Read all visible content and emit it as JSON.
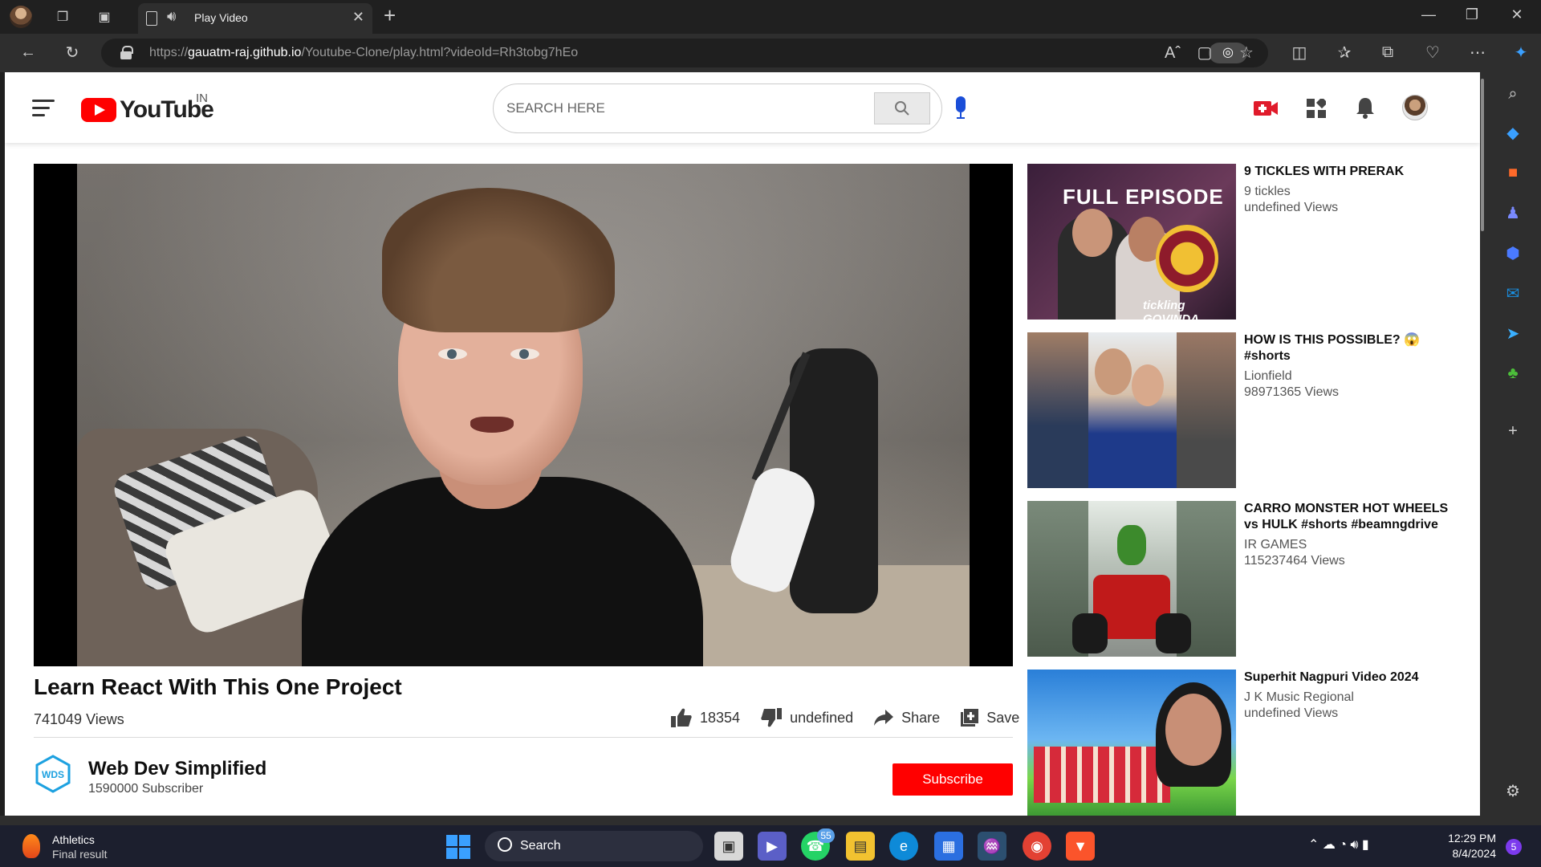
{
  "browser": {
    "tab_title": "Play Video",
    "url_prefix": "https://",
    "url_host": "gauatm-raj.github.io",
    "url_path": "/Youtube-Clone/play.html?videoId=Rh3tobg7hEo"
  },
  "youtube": {
    "logo_text": "YouTube",
    "region": "IN",
    "search_placeholder": "SEARCH HERE"
  },
  "video": {
    "title": "Learn React With This One Project",
    "views": "741049 Views",
    "likes": "18354",
    "dislikes": "undefined",
    "share_label": "Share",
    "save_label": "Save"
  },
  "channel": {
    "logo_text": "WDS",
    "name": "Web Dev Simplified",
    "subscribers": "1590000 Subscriber",
    "subscribe_label": "Subscribe"
  },
  "recommendations": [
    {
      "title": "9 TICKLES WITH PRERAK",
      "channel": "9 tickles",
      "views": "undefined Views",
      "thumb_text": "FULL EPISODE",
      "thumb_caption": "tickling GOVINDA"
    },
    {
      "title": "HOW IS THIS POSSIBLE? 😱 #shorts",
      "channel": "Lionfield",
      "views": "98971365 Views"
    },
    {
      "title": "CARRO MONSTER HOT WHEELS vs HULK #shorts #beamngdrive",
      "channel": "IR GAMES",
      "views": "115237464 Views"
    },
    {
      "title": "Superhit Nagpuri Video 2024",
      "channel": "J K Music Regional",
      "views": "undefined Views"
    }
  ],
  "taskbar": {
    "weather_title": "Athletics",
    "weather_subtitle": "Final result",
    "search_label": "Search",
    "whatsapp_badge": "55",
    "time": "12:29 PM",
    "date": "8/4/2024",
    "notification_count": "5"
  },
  "colors": {
    "youtube_red": "#ff0000",
    "mic_blue": "#1a4ed8",
    "chrome_dark": "#202020",
    "taskbar": "#1c1f2e"
  }
}
